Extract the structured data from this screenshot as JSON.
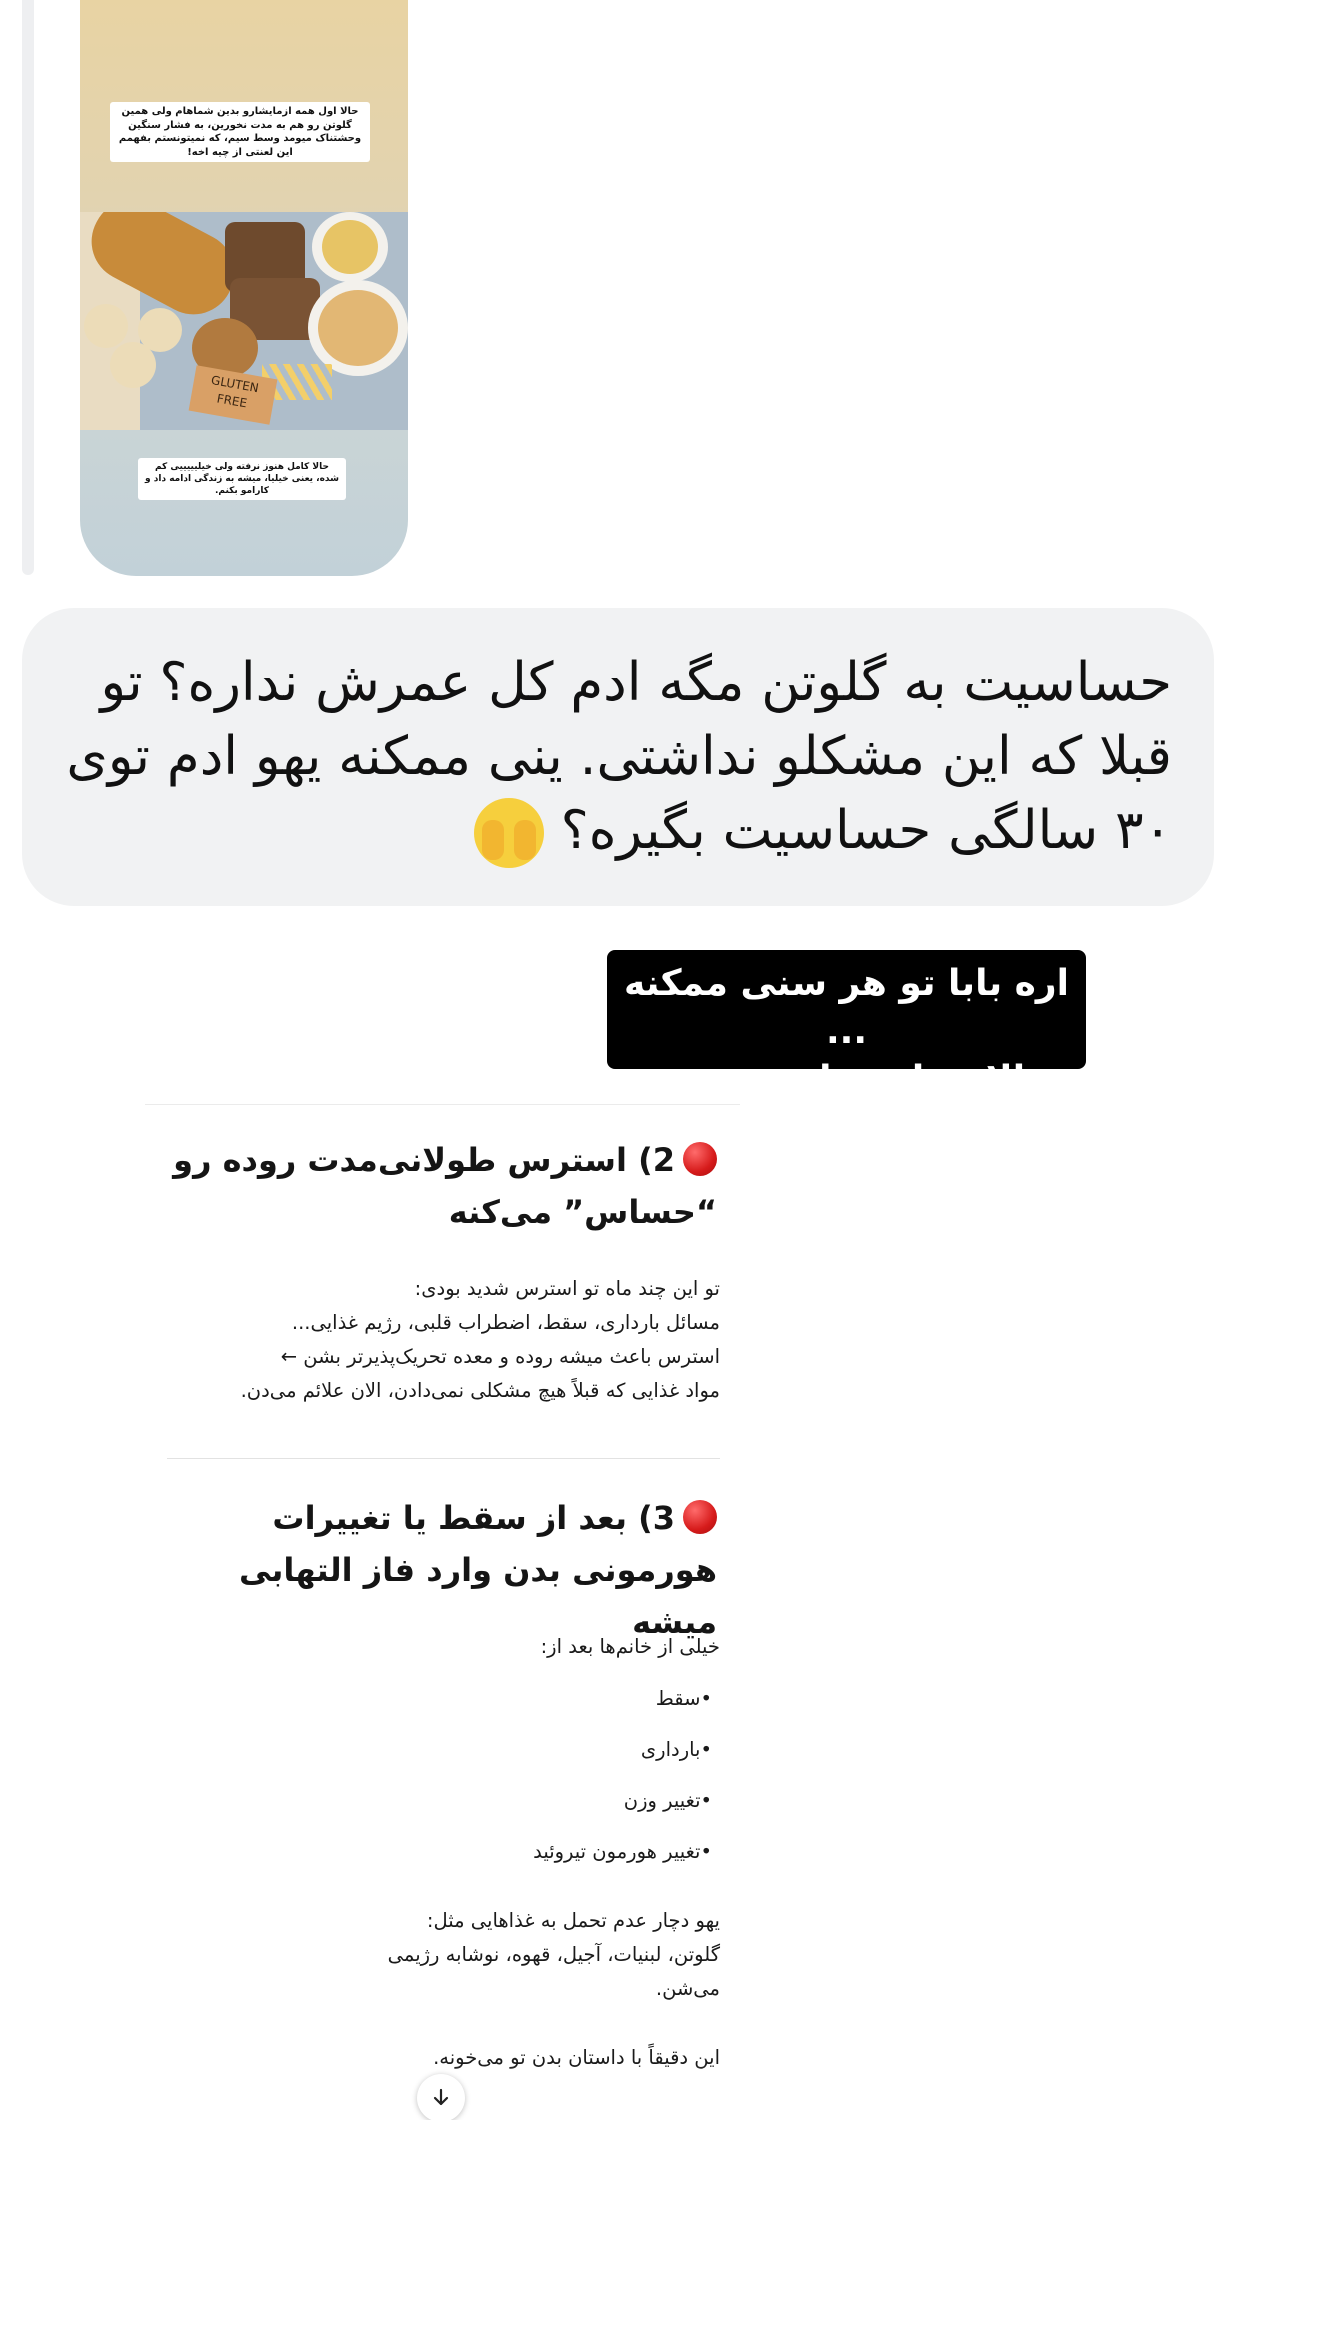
{
  "story": {
    "caption_top": "حالا اول همه ازمایشارو بدین شماهام ولی همین گلوتن رو هم به مدت نخورین، به فشار سنگین وحشتناک میومد وسط سیم، که نمیتونستم بفهمم این لعنتی از چیه اخه!",
    "caption_bottom": "حالا کامل هنوز نرفته ولی خیلیییییی کم شده، یعنی خیلیا، میشه به زندگی ادامه داد و کارامو بکنم.",
    "tag_text": "GLUTEN FREE"
  },
  "message": {
    "text": "حساسیت به گلوتن مگه ادم کل عمرش نداره؟ تو قبلا که این مشکلو نداشتی. ینی ممکنه یهو ادم توی ۳۰ سالگی حساسیت بگیره؟",
    "emoji": "face-with-hands-over-eyes"
  },
  "reply_card": {
    "line1": "اره بابا تو هر سنی ممکنه ...",
    "line2": "الان دارم راجع بهش میخونم:"
  },
  "article": {
    "section2": {
      "heading": "2) استرس طولانی‌مدت روده رو “حساس” می‌کنه",
      "lines": [
        "تو این چند ماه تو استرس شدید بودی:",
        "مسائل بارداری، سقط، اضطراب قلبی، رژیم غذایی...",
        "استرس باعث میشه روده و معده تحریک‌پذیرتر بشن ←",
        "مواد غذایی که قبلاً هیچ مشکلی نمی‌دادن، الان علائم می‌دن."
      ]
    },
    "section3": {
      "heading": "3) بعد از سقط یا تغییرات هورمونی بدن وارد فاز التهابی میشه",
      "intro": "خیلی از خانم‌ها بعد از:",
      "bullets": [
        "•سقط",
        "•بارداری",
        "•تغییر وزن",
        "•تغییر هورمون تیروئید"
      ],
      "para_lines": [
        "یهو دچار عدم تحمل به غذاهایی مثل:",
        "گلوتن، لبنیات، آجیل، قهوه، نوشابه رژیمی",
        "می‌شن."
      ],
      "closing": "این دقیقاً با داستان بدن تو می‌خونه."
    },
    "scroll_icon": "arrow-down-icon"
  }
}
